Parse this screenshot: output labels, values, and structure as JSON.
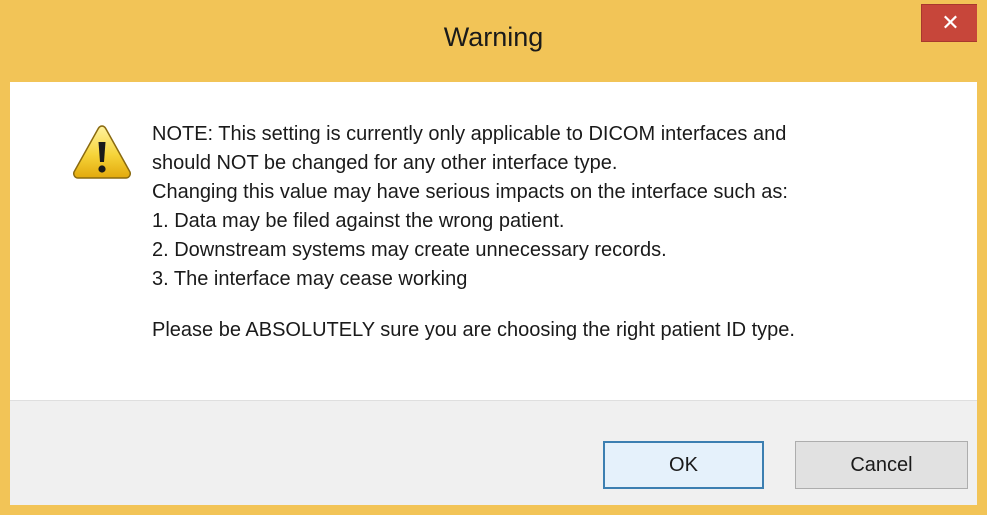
{
  "dialog": {
    "title": "Warning",
    "close_label": "✕"
  },
  "icons": {
    "warning": "warning-triangle-icon",
    "close": "close-icon"
  },
  "colors": {
    "frame": "#f2c457",
    "close_button": "#c7463a",
    "footer": "#f0f0f0",
    "ok_border": "#3c7fb1"
  },
  "message": {
    "line1": "NOTE: This setting is currently only applicable to DICOM interfaces and",
    "line2": "should NOT be changed for any other interface type.",
    "line3": "Changing this value may have serious impacts on the interface such as:",
    "line4": "1. Data may be filed against the wrong patient.",
    "line5": "2. Downstream systems may create unnecessary records.",
    "line6": "3. The interface may cease working",
    "line7": "Please be ABSOLUTELY sure you are choosing the right patient ID type."
  },
  "buttons": {
    "ok_label": "OK",
    "cancel_label": "Cancel"
  }
}
